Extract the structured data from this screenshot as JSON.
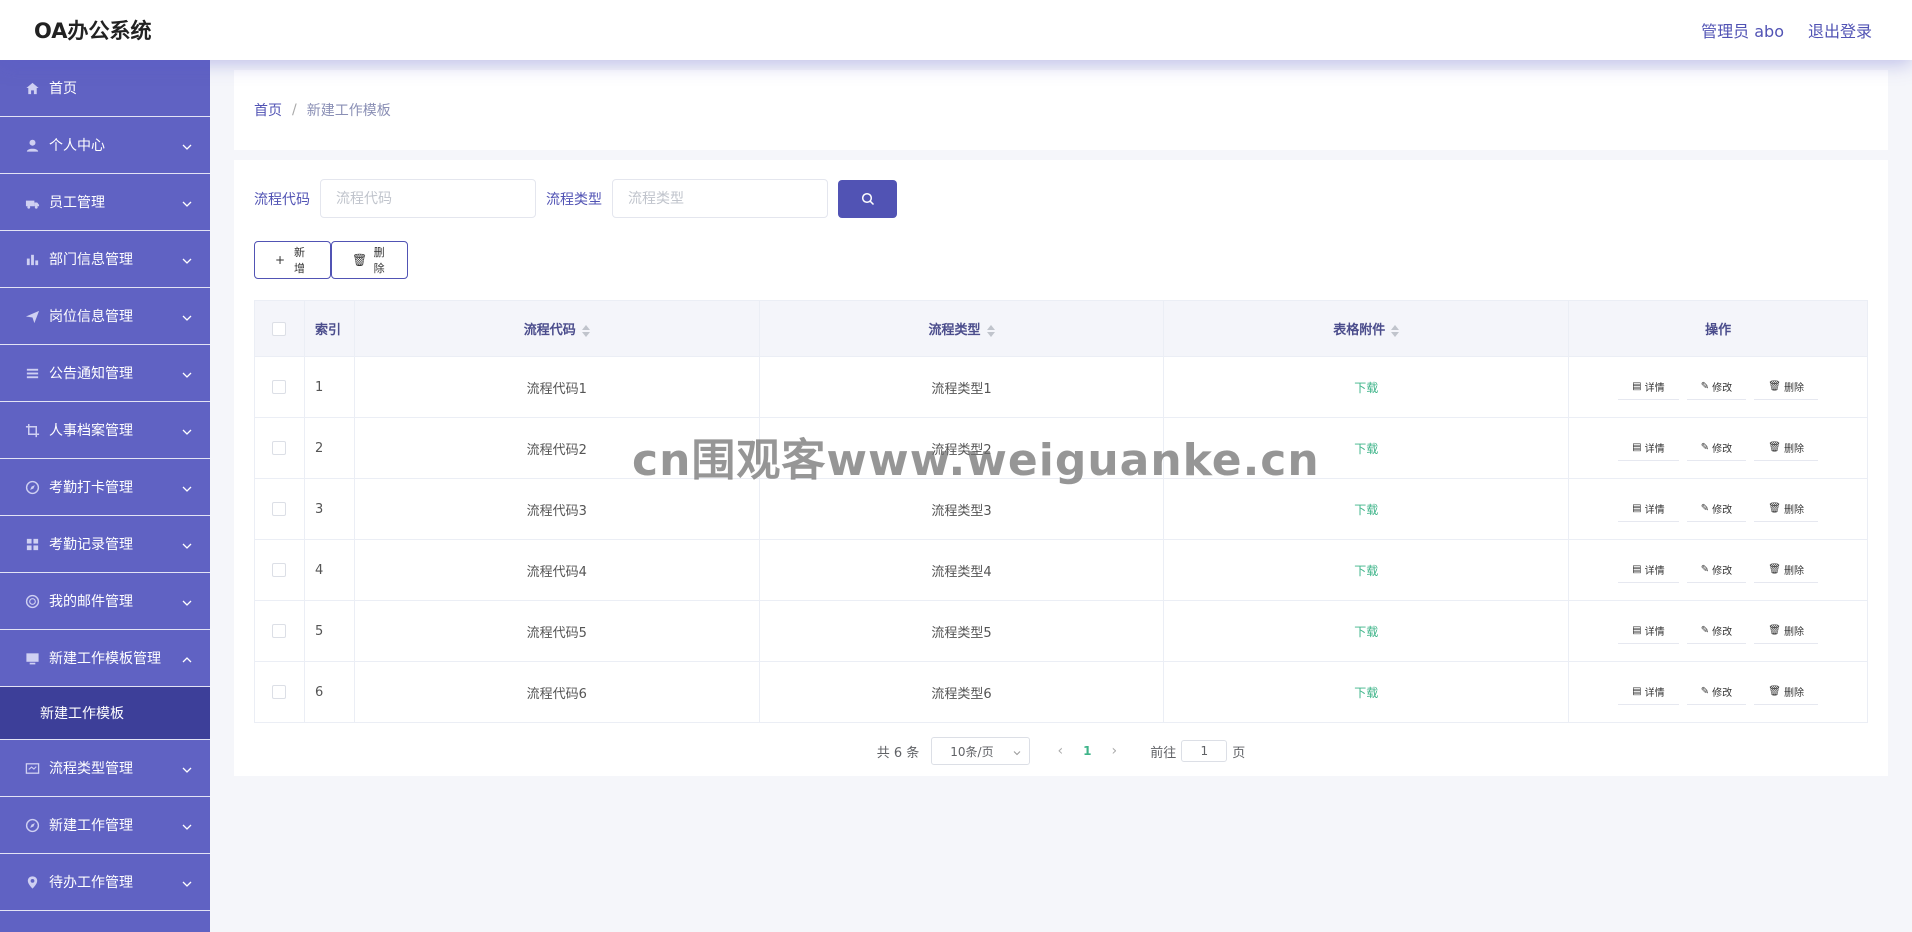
{
  "header": {
    "app_title": "OA办公系统",
    "user_label": "管理员 abo",
    "logout_label": "退出登录"
  },
  "sidebar": {
    "items": [
      {
        "label": "首页",
        "icon": "home-icon"
      },
      {
        "label": "个人中心",
        "icon": "user-icon"
      },
      {
        "label": "员工管理",
        "icon": "truck-icon"
      },
      {
        "label": "部门信息管理",
        "icon": "bar-chart-icon"
      },
      {
        "label": "岗位信息管理",
        "icon": "send-icon"
      },
      {
        "label": "公告通知管理",
        "icon": "list-icon"
      },
      {
        "label": "人事档案管理",
        "icon": "crop-icon"
      },
      {
        "label": "考勤打卡管理",
        "icon": "compass-icon"
      },
      {
        "label": "考勤记录管理",
        "icon": "grid-icon"
      },
      {
        "label": "我的邮件管理",
        "icon": "circle-icon"
      },
      {
        "label": "新建工作模板管理",
        "icon": "monitor-icon"
      }
    ],
    "active_sub": "新建工作模板",
    "items_after": [
      {
        "label": "流程类型管理",
        "icon": "card-icon"
      },
      {
        "label": "新建工作管理",
        "icon": "compass-icon"
      },
      {
        "label": "待办工作管理",
        "icon": "location-icon"
      }
    ]
  },
  "breadcrumb": {
    "home": "首页",
    "separator": "/",
    "current": "新建工作模板"
  },
  "search": {
    "code_label": "流程代码",
    "code_placeholder": "流程代码",
    "type_label": "流程类型",
    "type_placeholder": "流程类型"
  },
  "actions": {
    "add_label": "新增",
    "delete_label": "删除"
  },
  "table": {
    "headers": {
      "index": "索引",
      "code": "流程代码",
      "type": "流程类型",
      "file": "表格附件",
      "op": "操作"
    },
    "download_label": "下载",
    "op_labels": {
      "detail": "详情",
      "edit": "修改",
      "delete": "删除"
    },
    "rows": [
      {
        "index": "1",
        "code": "流程代码1",
        "type": "流程类型1"
      },
      {
        "index": "2",
        "code": "流程代码2",
        "type": "流程类型2"
      },
      {
        "index": "3",
        "code": "流程代码3",
        "type": "流程类型3"
      },
      {
        "index": "4",
        "code": "流程代码4",
        "type": "流程类型4"
      },
      {
        "index": "5",
        "code": "流程代码5",
        "type": "流程类型5"
      },
      {
        "index": "6",
        "code": "流程代码6",
        "type": "流程类型6"
      }
    ]
  },
  "pagination": {
    "total": "共 6 条",
    "page_size": "10条/页",
    "current_page": "1",
    "goto_label": "前往",
    "goto_value": "1",
    "page_suffix": "页"
  },
  "watermark": "cn围观客www.weiguanke.cn",
  "colors": {
    "sidebar_bg": "#6062c3",
    "active_sub_bg": "#3d3f99",
    "accent": "#5153b4",
    "download": "#3eb489"
  }
}
